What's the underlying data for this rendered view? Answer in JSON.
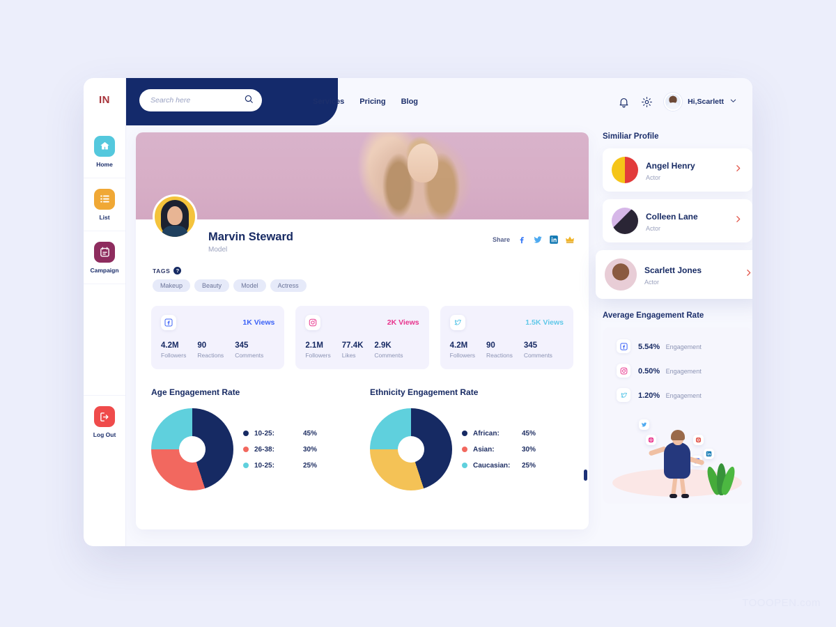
{
  "brand": {
    "logo": "IN"
  },
  "search": {
    "placeholder": "Search here",
    "value": "",
    "icon": "search-icon"
  },
  "mainnav": {
    "items": [
      {
        "label": "Services"
      },
      {
        "label": "Pricing"
      },
      {
        "label": "Blog"
      }
    ]
  },
  "topright": {
    "bell_icon": "bell-icon",
    "gear_icon": "gear-icon",
    "user_greeting": "Hi,Scarlett",
    "chevron_icon": "chevron-down-icon"
  },
  "sidebar": {
    "items": [
      {
        "label": "Home",
        "icon": "home-icon",
        "color": "#54c8dd"
      },
      {
        "label": "List",
        "icon": "list-icon",
        "color": "#f0a835"
      },
      {
        "label": "Campaign",
        "icon": "calendar-icon",
        "color": "#8e2c5e"
      },
      {
        "label": "Log Out",
        "icon": "logout-icon",
        "color": "#ef4b4b"
      }
    ]
  },
  "profile": {
    "name": "Marvin Steward",
    "role": "Model",
    "share_label": "Share",
    "share_icons": [
      "facebook-icon",
      "twitter-icon",
      "linkedin-icon",
      "crown-icon"
    ],
    "tags_label": "TAGS",
    "tags_help": "?",
    "tags": [
      "Makeup",
      "Beauty",
      "Model",
      "Actress"
    ]
  },
  "stats": [
    {
      "platform": "facebook",
      "icon": "facebook-icon",
      "views": "1K Views",
      "views_color": "#3b62f6",
      "metrics": [
        {
          "value": "4.2M",
          "label": "Followers"
        },
        {
          "value": "90",
          "label": "Reactions"
        },
        {
          "value": "345",
          "label": "Comments"
        }
      ]
    },
    {
      "platform": "instagram",
      "icon": "instagram-icon",
      "views": "2K Views",
      "views_color": "#e8338c",
      "metrics": [
        {
          "value": "2.1M",
          "label": "Followers"
        },
        {
          "value": "77.4K",
          "label": "Likes"
        },
        {
          "value": "2.9K",
          "label": "Comments"
        }
      ]
    },
    {
      "platform": "twitter",
      "icon": "twitter-icon",
      "views": "1.5K Views",
      "views_color": "#5fc8e8",
      "metrics": [
        {
          "value": "4.2M",
          "label": "Followers"
        },
        {
          "value": "90",
          "label": "Reactions"
        },
        {
          "value": "345",
          "label": "Comments"
        }
      ]
    }
  ],
  "chart_data": [
    {
      "type": "pie",
      "title": "Age Engagement Rate",
      "categories": [
        "10-25:",
        "26-38:",
        "10-25:"
      ],
      "values": [
        45,
        30,
        25
      ],
      "value_labels": [
        "45%",
        "30%",
        "25%"
      ],
      "colors": [
        "#162a63",
        "#f2685f",
        "#5fd0dd"
      ],
      "legend_colors": [
        "#162a63",
        "#f2685f",
        "#5fd0dd"
      ],
      "legend": "right",
      "donut": true
    },
    {
      "type": "pie",
      "title": "Ethnicity Engagement Rate",
      "categories": [
        "African:",
        "Asian:",
        "Caucasian:"
      ],
      "values": [
        45,
        30,
        25
      ],
      "value_labels": [
        "45%",
        "30%",
        "25%"
      ],
      "colors": [
        "#162a63",
        "#f4c256",
        "#5fd0dd"
      ],
      "legend_colors": [
        "#162a63",
        "#f2685f",
        "#5fd0dd"
      ],
      "legend": "right",
      "donut": true
    }
  ],
  "similar": {
    "title": "Similiar Profile",
    "items": [
      {
        "name": "Angel Henry",
        "role": "Actor",
        "arrow": "chevron-right-icon"
      },
      {
        "name": "Colleen Lane",
        "role": "Actor",
        "arrow": "chevron-right-icon"
      },
      {
        "name": "Scarlett Jones",
        "role": "Actor",
        "arrow": "chevron-right-icon"
      }
    ]
  },
  "engagement": {
    "title": "Average Engagement Rate",
    "rows": [
      {
        "icon": "facebook-icon",
        "value": "5.54%",
        "label": "Engagement"
      },
      {
        "icon": "instagram-icon",
        "value": "0.50%",
        "label": "Engagement"
      },
      {
        "icon": "twitter-icon",
        "value": "1.20%",
        "label": "Engagement"
      }
    ]
  },
  "watermark": {
    "text": "TOOOPEN.com"
  }
}
